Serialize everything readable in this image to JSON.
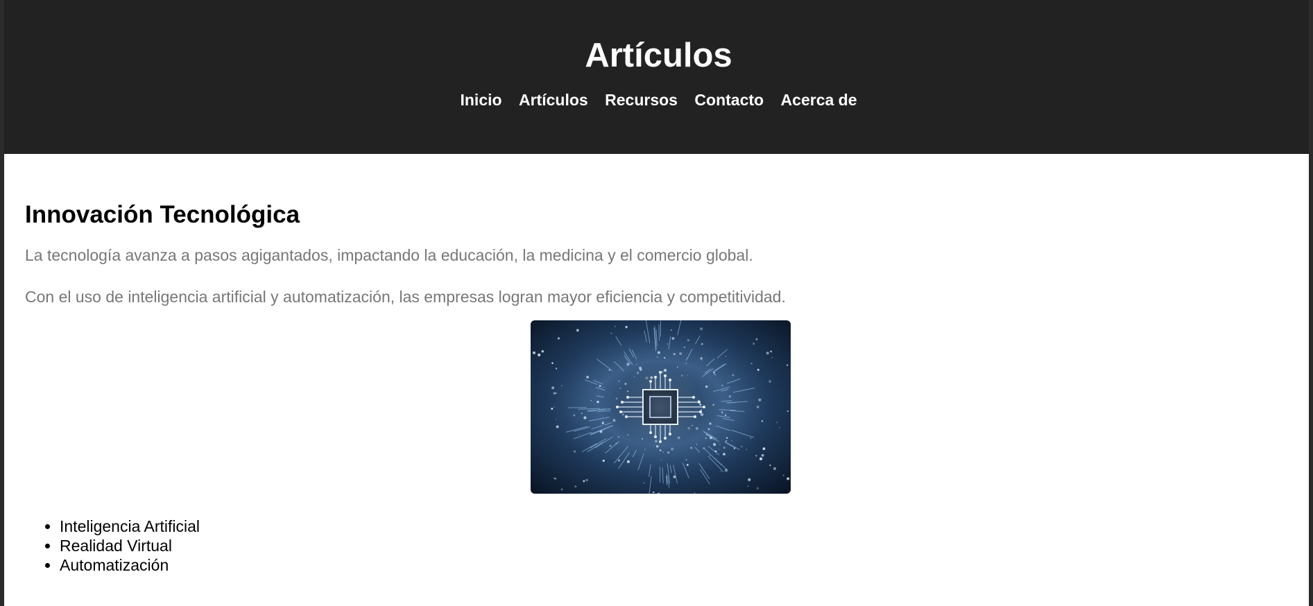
{
  "header": {
    "title": "Artículos",
    "nav": [
      {
        "label": "Inicio"
      },
      {
        "label": "Artículos"
      },
      {
        "label": "Recursos"
      },
      {
        "label": "Contacto"
      },
      {
        "label": "Acerca de"
      }
    ]
  },
  "article": {
    "heading": "Innovación Tecnológica",
    "paragraphs": [
      "La tecnología avanza a pasos agigantados, impactando la educación, la medicina y el comercio global.",
      "Con el uso de inteligencia artificial y automatización, las empresas logran mayor eficiencia y competitividad."
    ],
    "image": {
      "icon": "circuit-chip-image"
    },
    "list": [
      "Inteligencia Artificial",
      "Realidad Virtual",
      "Automatización"
    ]
  },
  "colors": {
    "header_bg": "#222222",
    "header_text": "#ffffff",
    "paragraph_text": "#777777",
    "body_bg": "#ffffff"
  }
}
